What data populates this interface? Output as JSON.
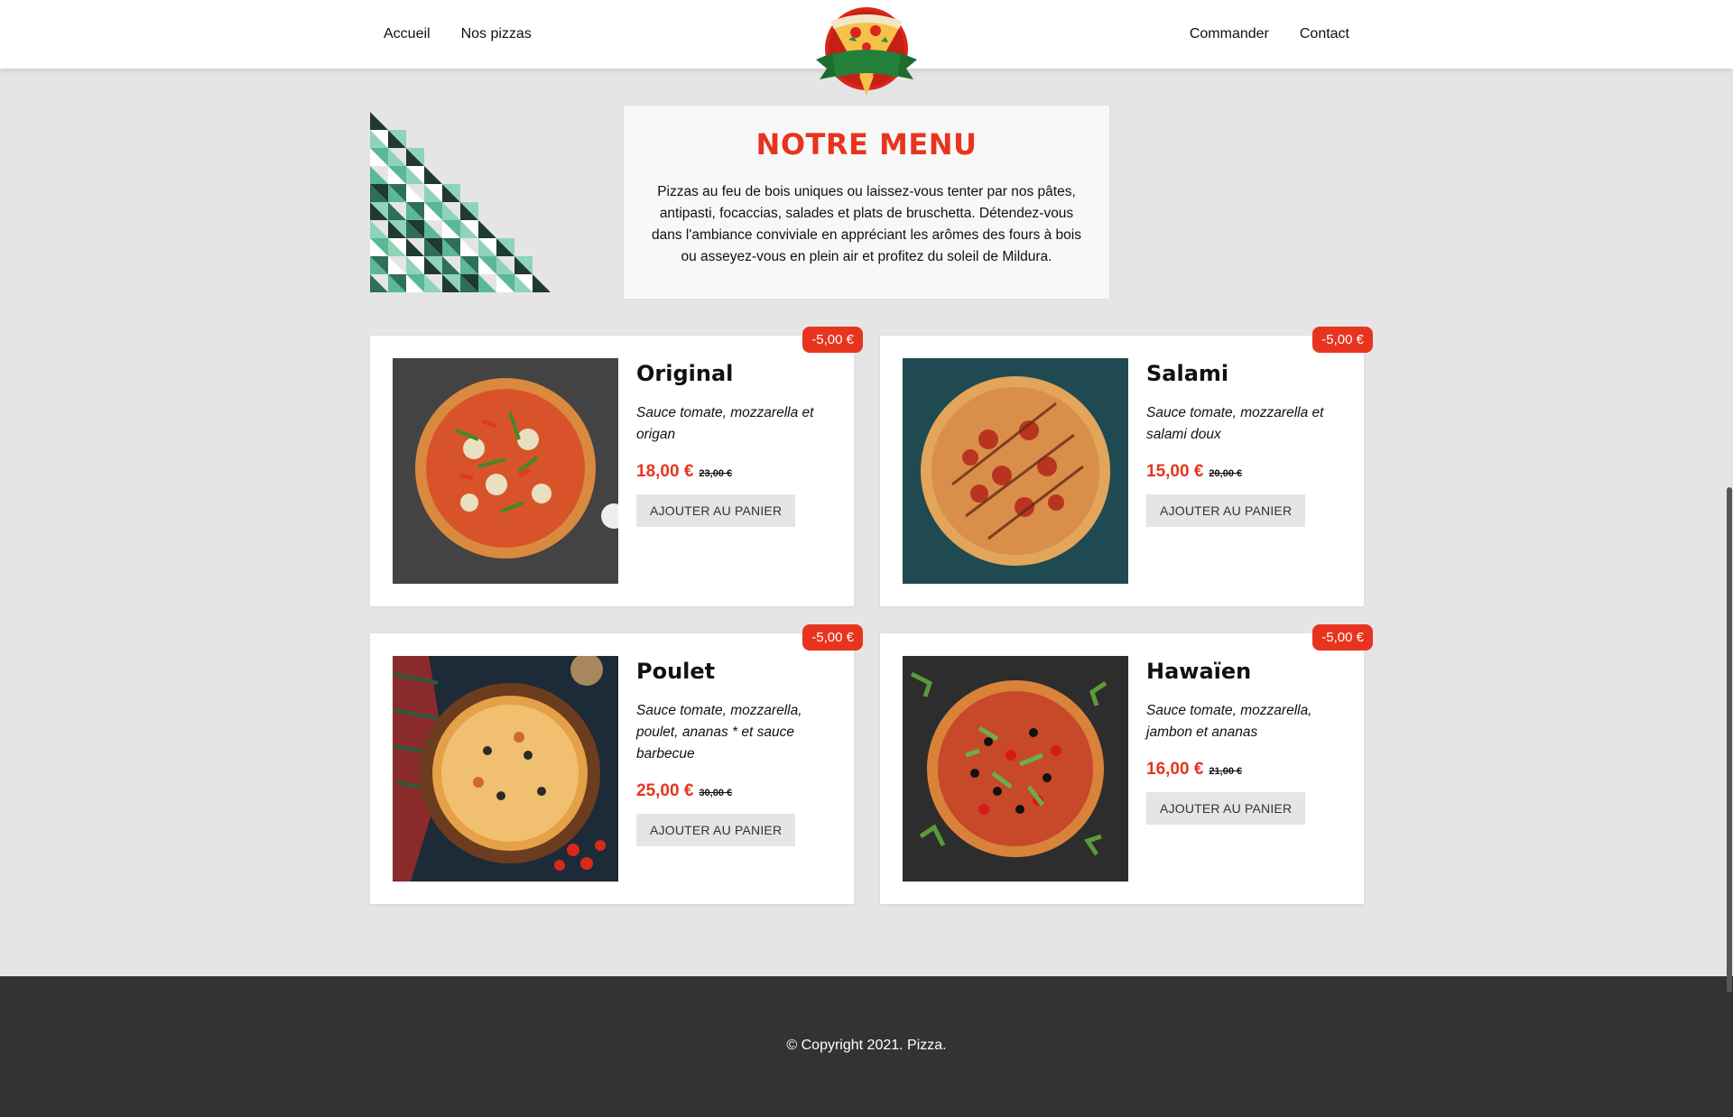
{
  "nav": {
    "left": [
      "Accueil",
      "Nos pizzas"
    ],
    "right": [
      "Commander",
      "Contact"
    ]
  },
  "intro": {
    "title": "NOTRE MENU",
    "text": "Pizzas au feu de bois uniques ou laissez-vous tenter par nos pâtes, antipasti, focaccias, salades et plats de bruschetta. Détendez-vous dans l'ambiance conviviale en appréciant les arômes des fours à bois ou asseyez-vous en plein air et profitez du soleil de Mildura."
  },
  "pizzas": [
    {
      "name": "Original",
      "desc": "Sauce tomate, mozzarella et origan",
      "price": "18,00 €",
      "old_price": "23,00 €",
      "badge": "-5,00 €",
      "button": "AJOUTER AU PANIER"
    },
    {
      "name": "Salami",
      "desc": "Sauce tomate, mozzarella et salami doux",
      "price": "15,00 €",
      "old_price": "20,00 €",
      "badge": "-5,00 €",
      "button": "AJOUTER AU PANIER"
    },
    {
      "name": "Poulet",
      "desc": "Sauce tomate, mozzarella, poulet, ananas * et sauce barbecue",
      "price": "25,00 €",
      "old_price": "30,00 €",
      "badge": "-5,00 €",
      "button": "AJOUTER AU PANIER"
    },
    {
      "name": "Hawaïen",
      "desc": "Sauce tomate, mozzarella, jambon et ananas",
      "price": "16,00 €",
      "old_price": "21,00 €",
      "badge": "-5,00 €",
      "button": "AJOUTER AU PANIER"
    }
  ],
  "footer": {
    "copyright": "© Copyright 2021. Pizza."
  },
  "colors": {
    "accent": "#e8341f",
    "footer_bg": "#333333",
    "page_bg": "#e5e5e5"
  }
}
